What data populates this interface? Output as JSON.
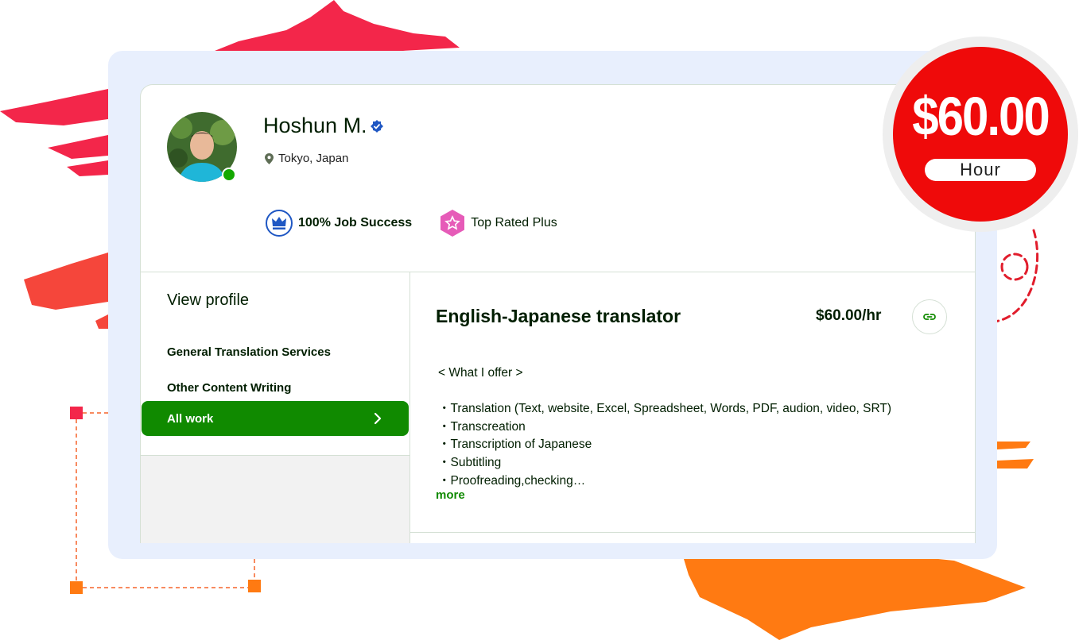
{
  "profile": {
    "name": "Hoshun M.",
    "location": "Tokyo, Japan",
    "job_success": "100% Job Success",
    "top_rated": "Top Rated Plus"
  },
  "sidebar": {
    "title": "View profile",
    "items": [
      {
        "label": "General Translation Services"
      },
      {
        "label": "Other Content Writing"
      },
      {
        "label": "All work"
      }
    ]
  },
  "main": {
    "title": "English-Japanese translator",
    "rate": "$60.00/hr",
    "description": {
      "heading": "< What I offer >",
      "items": [
        "・Translation (Text, website, Excel, Spreadsheet, Words, PDF, audion, video, SRT)",
        "・Transcreation",
        "・Transcription of Japanese",
        "・Subtitling",
        "・Proofreading,checking…"
      ]
    },
    "more_label": "more"
  },
  "price_badge": {
    "amount": "$60.00",
    "unit": "Hour"
  },
  "colors": {
    "accent_green": "#108a00",
    "badge_red": "#ef0a0a",
    "frame_bg": "#e8effd",
    "brush_red": "#f3324a",
    "brush_orange": "#ff7a12"
  }
}
